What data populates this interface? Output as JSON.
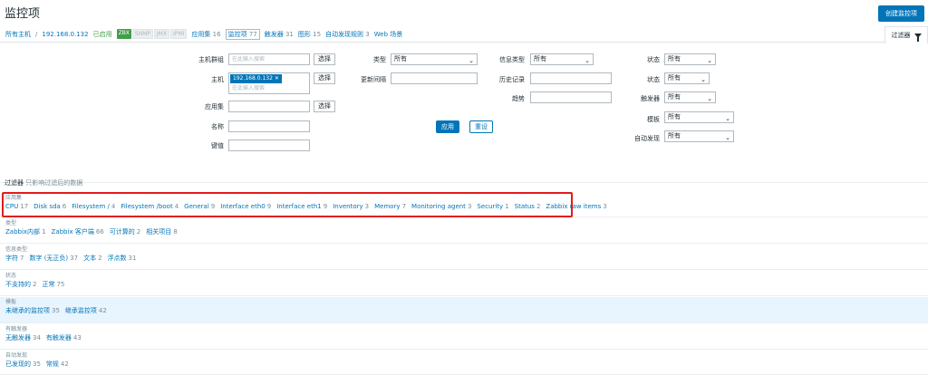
{
  "header": {
    "title": "监控项",
    "create_label": "创建监控项"
  },
  "nav": {
    "all_hosts": "所有主机",
    "separator": "/",
    "host": "192.168.0.132",
    "enabled": "已启用",
    "badges": [
      "ZBX",
      "SNMP",
      "JMX",
      "IPMI"
    ],
    "links": [
      {
        "label": "应用集",
        "count": "16"
      },
      {
        "label": "监控项",
        "count": "77"
      },
      {
        "label": "触发器",
        "count": "31"
      },
      {
        "label": "图形",
        "count": "15"
      },
      {
        "label": "自动发现规则",
        "count": "3"
      },
      {
        "label": "Web 场景",
        "count": ""
      }
    ]
  },
  "filter_tab": {
    "label": "过滤器"
  },
  "filter": {
    "host_group_label": "主机群组",
    "host_group_placeholder": "在此输入搜索",
    "select_label": "选择",
    "host_label": "主机",
    "host_chip": "192.168.0.132",
    "host_placeholder": "在此输入搜索",
    "application_label": "应用集",
    "name_label": "名称",
    "key_label": "键值",
    "type_label": "类型",
    "type_value": "所有",
    "update_interval_label": "更新间隔",
    "info_type_label": "信息类型",
    "info_type_value": "所有",
    "history_label": "历史记录",
    "trends_label": "趋势",
    "state_label": "状态",
    "state_value": "所有",
    "status_label": "状态",
    "status_value": "所有",
    "triggers_label": "触发器",
    "triggers_value": "所有",
    "template_label": "模板",
    "template_value": "所有",
    "discovery_label": "自动发现",
    "discovery_value": "所有",
    "apply_label": "应用",
    "reset_label": "重设"
  },
  "subfilter_note": {
    "label": "过滤器",
    "text": "只影响过滤后的数据"
  },
  "subfilters": [
    {
      "title": "应用集",
      "items": [
        {
          "label": "CPU",
          "count": "17"
        },
        {
          "label": "Disk sda",
          "count": "6"
        },
        {
          "label": "Filesystem /",
          "count": "4"
        },
        {
          "label": "Filesystem /boot",
          "count": "4"
        },
        {
          "label": "General",
          "count": "9"
        },
        {
          "label": "Interface eth0",
          "count": "9"
        },
        {
          "label": "Interface eth1",
          "count": "9"
        },
        {
          "label": "Inventory",
          "count": "3"
        },
        {
          "label": "Memory",
          "count": "7"
        },
        {
          "label": "Monitoring agent",
          "count": "3"
        },
        {
          "label": "Security",
          "count": "1"
        },
        {
          "label": "Status",
          "count": "2"
        },
        {
          "label": "Zabbix raw items",
          "count": "3"
        }
      ]
    },
    {
      "title": "类型",
      "items": [
        {
          "label": "Zabbix内部",
          "count": "1"
        },
        {
          "label": "Zabbix 客户端",
          "count": "66"
        },
        {
          "label": "可计算的",
          "count": "2"
        },
        {
          "label": "相关项目",
          "count": "8"
        }
      ]
    },
    {
      "title": "信息类型",
      "items": [
        {
          "label": "字符",
          "count": "7"
        },
        {
          "label": "数字 (无正负)",
          "count": "37"
        },
        {
          "label": "文本",
          "count": "2"
        },
        {
          "label": "浮点数",
          "count": "31"
        }
      ]
    },
    {
      "title": "状态",
      "items": [
        {
          "label": "不支持的",
          "count": "2"
        },
        {
          "label": "正常",
          "count": "75"
        }
      ]
    },
    {
      "title": "模板",
      "items": [
        {
          "label": "未继承的监控项",
          "count": "35"
        },
        {
          "label": "继承监控项",
          "count": "42"
        }
      ]
    },
    {
      "title": "有触发器",
      "items": [
        {
          "label": "无触发器",
          "count": "34"
        },
        {
          "label": "有触发器",
          "count": "43"
        }
      ]
    },
    {
      "title": "自动发现",
      "items": [
        {
          "label": "已发现的",
          "count": "35"
        },
        {
          "label": "常规",
          "count": "42"
        }
      ]
    }
  ]
}
